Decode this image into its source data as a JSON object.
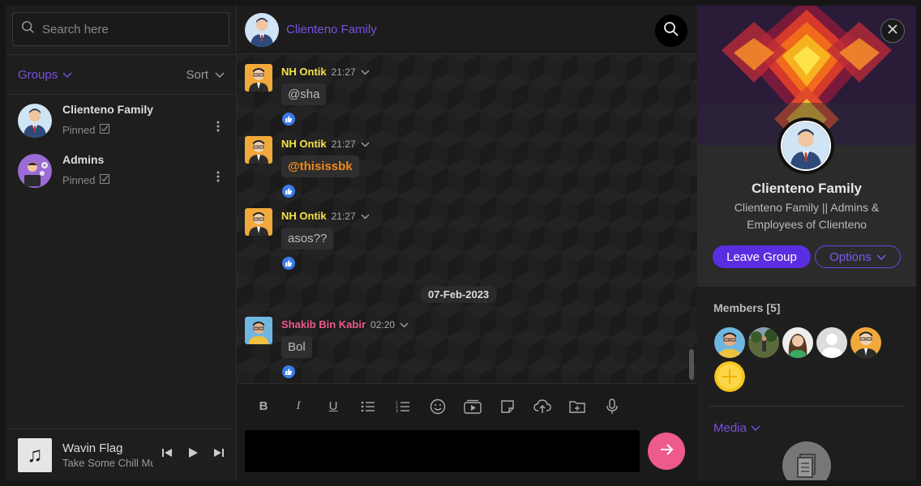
{
  "search": {
    "placeholder": "Search here"
  },
  "sidebar": {
    "groups_label": "Groups",
    "sort_label": "Sort",
    "groups": [
      {
        "name": "Clienteno Family",
        "status": "Pinned"
      },
      {
        "name": "Admins",
        "status": "Pinned"
      }
    ]
  },
  "player": {
    "song": "Wavin Flag",
    "artist": "Take Some Chill Music"
  },
  "chat": {
    "title": "Clienteno Family",
    "messages": [
      {
        "sender": "NH Ontik",
        "time": "21:27",
        "text": "@sha",
        "sender_color": "#f4e24a"
      },
      {
        "sender": "NH Ontik",
        "time": "21:27",
        "text": "@thisissbk",
        "sender_color": "#f4e24a",
        "text_color": "#f08a1a"
      },
      {
        "sender": "NH Ontik",
        "time": "21:27",
        "text": "asos??",
        "sender_color": "#f4e24a"
      },
      {
        "sender": "Shakib Bin Kabir",
        "time": "02:20",
        "text": "Bol",
        "sender_color": "#ee5a8a"
      }
    ],
    "date_separator": "07-Feb-2023",
    "toolbar": {
      "bold": "B",
      "italic": "I",
      "underline": "U",
      "icons": [
        "bold-icon",
        "italic-icon",
        "underline-icon",
        "bullet-list-icon",
        "numbered-list-icon",
        "emoji-icon",
        "media-icon",
        "sticker-icon",
        "upload-icon",
        "folder-add-icon",
        "microphone-icon"
      ]
    },
    "composer": {
      "value": ""
    }
  },
  "group_info": {
    "name": "Clienteno Family",
    "description": "Clienteno Family || Admins & Employees of Clienteno",
    "leave_label": "Leave Group",
    "options_label": "Options",
    "members_label": "Members [5]",
    "media_label": "Media"
  },
  "colors": {
    "accent": "#7b4fe0",
    "send_button": "#ee5a8a",
    "like": "#3b7be8"
  }
}
